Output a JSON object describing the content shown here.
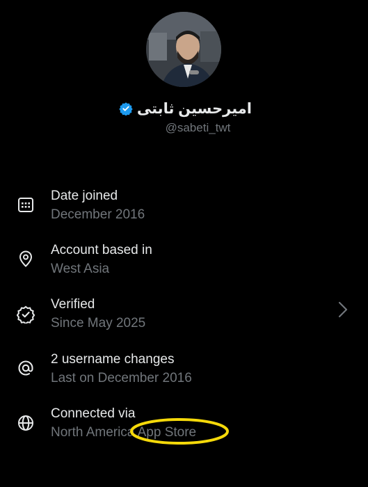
{
  "profile": {
    "display_name": "امیرحسین ثابتی",
    "handle": "@sabeti_twt",
    "verified_badge_color": "#1d9bf0"
  },
  "about_rows": [
    {
      "icon": "calendar-icon",
      "title": "Date joined",
      "subtitle": "December 2016"
    },
    {
      "icon": "location-pin-icon",
      "title": "Account based in",
      "subtitle": "West Asia"
    },
    {
      "icon": "verified-badge-icon",
      "title": "Verified",
      "subtitle": "Since May 2025"
    },
    {
      "icon": "at-sign-icon",
      "title": "2 username changes",
      "subtitle": "Last on December 2016"
    },
    {
      "icon": "globe-icon",
      "title": "Connected via",
      "subtitle": "North America App Store"
    }
  ],
  "annotation": {
    "highlight_color": "#f5d90a"
  },
  "colors": {
    "background": "#000000",
    "primary_text": "#e7e9ea",
    "secondary_text": "#71767b"
  }
}
